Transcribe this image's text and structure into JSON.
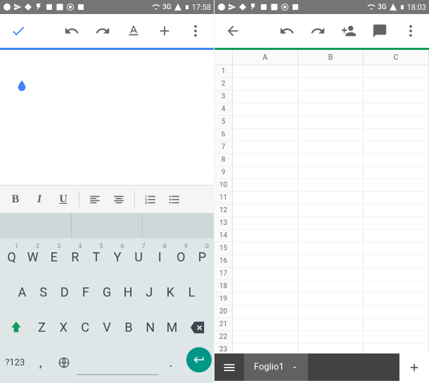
{
  "left": {
    "status": {
      "signal": "3G",
      "time": "17:58"
    },
    "keyboard": {
      "row1": [
        "Q",
        "W",
        "E",
        "R",
        "T",
        "Y",
        "U",
        "I",
        "O",
        "P"
      ],
      "row1sup": [
        "1",
        "2",
        "3",
        "4",
        "5",
        "6",
        "7",
        "8",
        "9",
        "0"
      ],
      "row2": [
        "A",
        "S",
        "D",
        "F",
        "G",
        "H",
        "J",
        "K",
        "L"
      ],
      "row3": [
        "Z",
        "X",
        "C",
        "V",
        "B",
        "N",
        "M"
      ],
      "sym": "?123",
      "comma": ",",
      "period": "."
    },
    "fmt": {
      "b": "B",
      "i": "I",
      "u": "U"
    }
  },
  "right": {
    "status": {
      "signal": "3G",
      "time": "18:03"
    },
    "sheet": {
      "cols": [
        "A",
        "B",
        "C"
      ],
      "rows": 23,
      "tab_name": "Foglio1"
    }
  }
}
